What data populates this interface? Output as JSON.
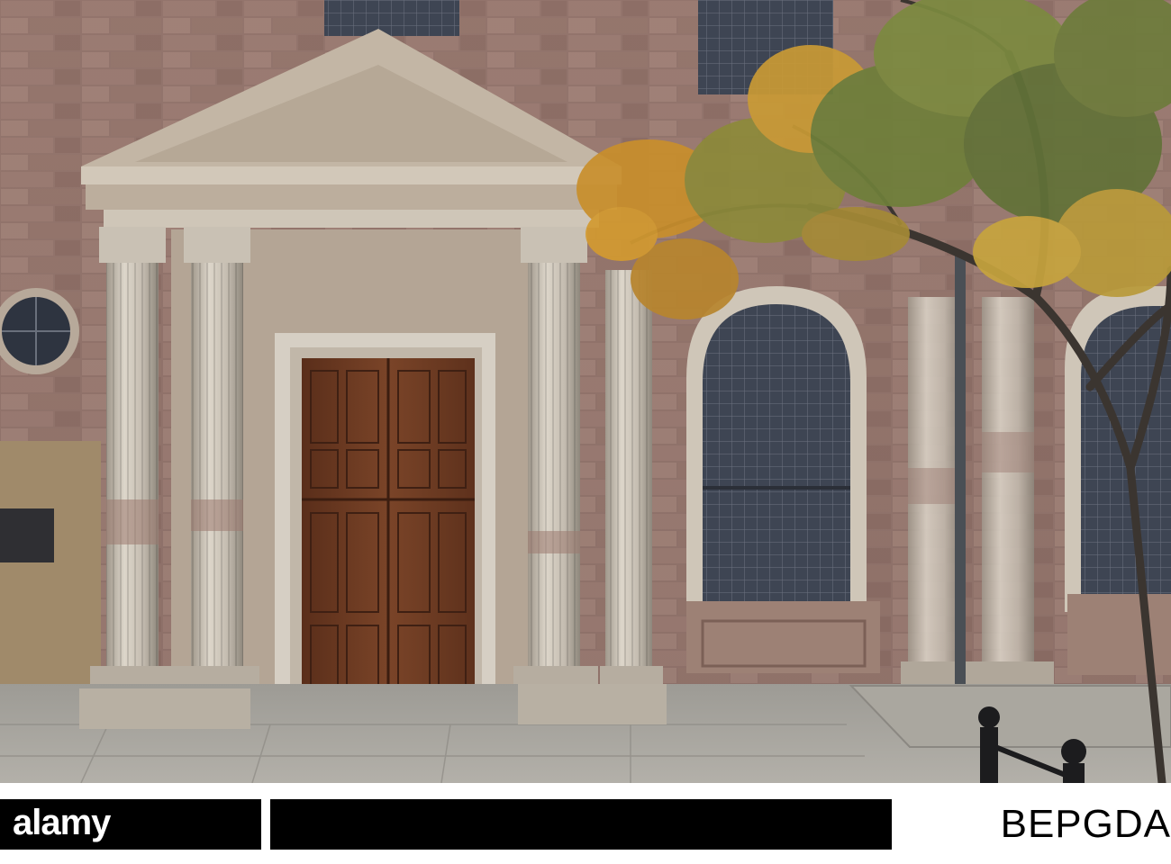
{
  "scene": {
    "subject": "church-facade",
    "colors": {
      "sandstone_red": "#8c6a62",
      "sandstone_pale": "#b9ab9a",
      "column_stone": "#c9c2b6",
      "door_wood": "#6b3a22",
      "window_glass": "#3d4452",
      "pavement": "#a7a49d",
      "foliage_gold": "#c98f2c",
      "foliage_green": "#6f7f3a"
    }
  },
  "watermark": {
    "brand": "alamy",
    "image_id": "BEPGDA"
  }
}
